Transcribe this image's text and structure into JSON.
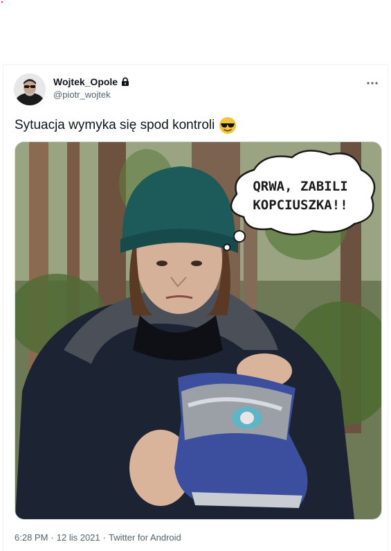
{
  "author": {
    "display_name": "Wojtek_Opole",
    "handle": "@piotr_wojtek"
  },
  "tweet": {
    "text": "Sytuacja wymyka się spod kontroli",
    "emoji": "smiling-face-with-sunglasses"
  },
  "media": {
    "bubble_line1": "QRWA, ZABILI",
    "bubble_line2": "KOPCIUSZKA!!"
  },
  "meta": {
    "time": "6:28 PM",
    "separator": "·",
    "date": "12 lis 2021",
    "source": "Twitter for Android"
  },
  "colors": {
    "text_primary": "#0f1419",
    "text_secondary": "#536471",
    "border": "#eff3f4",
    "emoji_yellow": "#f5c33b",
    "hat_teal": "#1d5a5a",
    "boot_blue": "#3b4f9e"
  },
  "icons": {
    "lock": "lock-icon",
    "more": "more-icon"
  }
}
